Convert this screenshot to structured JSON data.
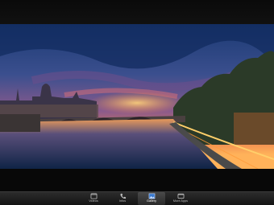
{
  "photo": {
    "subject": "Paris city skyline at sunset over the Seine with bridge"
  },
  "tab_bar": {
    "items": [
      {
        "label": "Videos",
        "icon": "video-icon",
        "active": false
      },
      {
        "label": "Infos",
        "icon": "phone-icon",
        "active": false
      },
      {
        "label": "Gallery",
        "icon": "gallery-icon",
        "active": true
      },
      {
        "label": "More Apps",
        "icon": "apps-icon",
        "active": false
      }
    ]
  },
  "colors": {
    "sky_top": "#1d3f7a",
    "sunset": "#ff8a3c",
    "water": "#1d3b66",
    "tab_bar": "#1e1e1e"
  }
}
